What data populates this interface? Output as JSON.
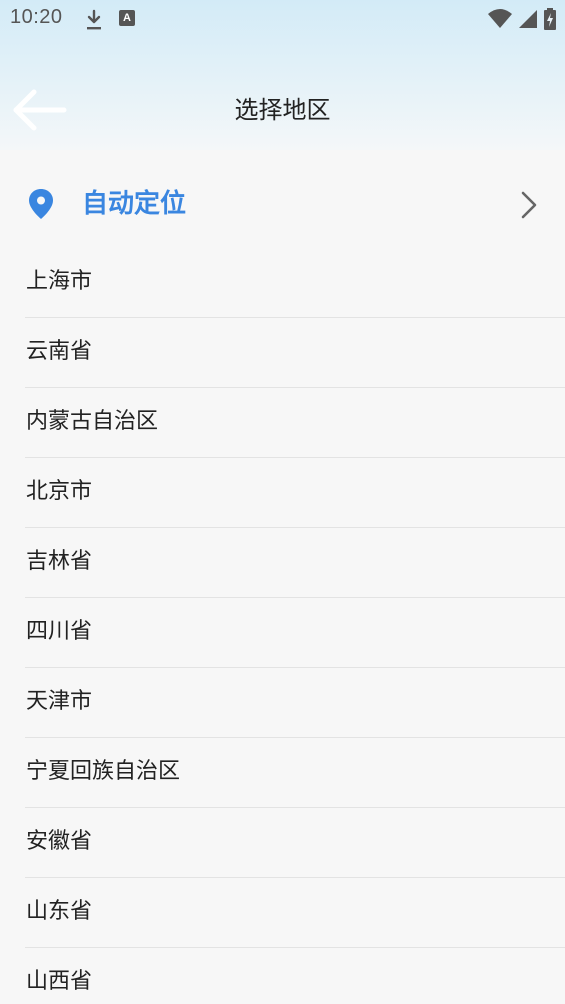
{
  "status_bar": {
    "time": "10:20",
    "icons": [
      "download-icon",
      "font-a-icon",
      "wifi-icon",
      "signal-icon",
      "battery-icon"
    ],
    "a_glyph": "A"
  },
  "header": {
    "title": "选择地区",
    "back_icon": "arrow-left-icon"
  },
  "auto_location": {
    "label": "自动定位",
    "icon": "location-pin-icon",
    "chevron": "chevron-right-icon",
    "color": "#3a86e0"
  },
  "regions": [
    {
      "label": "上海市"
    },
    {
      "label": "云南省"
    },
    {
      "label": "内蒙古自治区"
    },
    {
      "label": "北京市"
    },
    {
      "label": "吉林省"
    },
    {
      "label": "四川省"
    },
    {
      "label": "天津市"
    },
    {
      "label": "宁夏回族自治区"
    },
    {
      "label": "安徽省"
    },
    {
      "label": "山东省"
    },
    {
      "label": "山西省"
    }
  ]
}
